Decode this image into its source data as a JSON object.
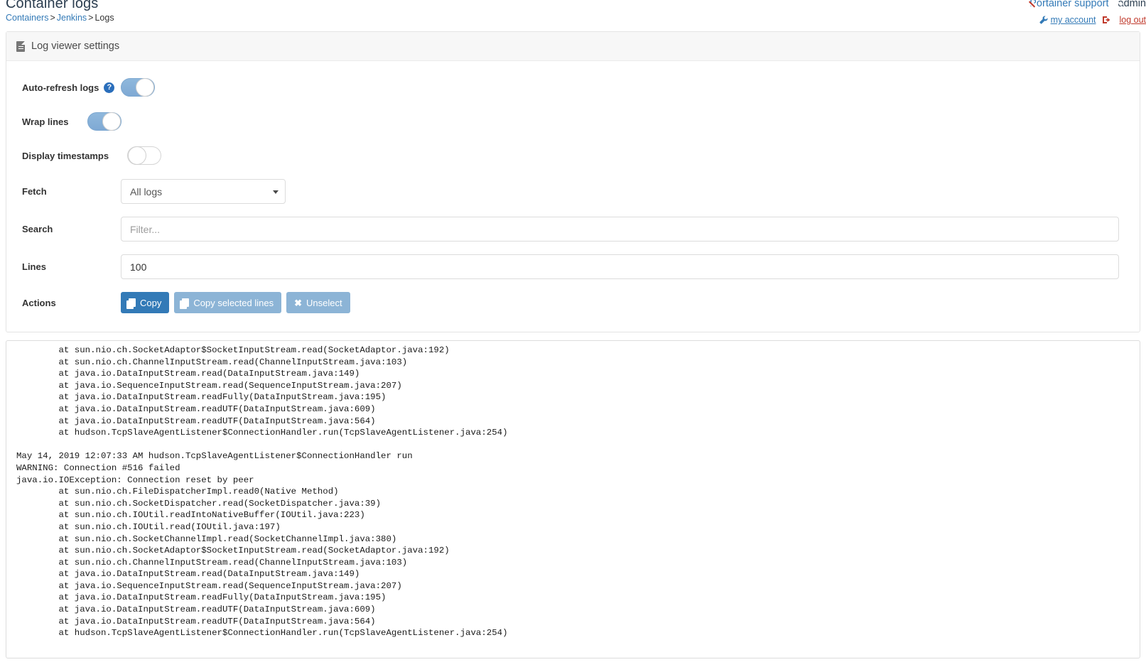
{
  "header": {
    "title": "Container logs",
    "breadcrumb": {
      "containers": "Containers",
      "separator1": ">",
      "jenkins": "Jenkins",
      "separator2": ">",
      "current": "Logs"
    },
    "support_label": "Portainer support",
    "user_name": "admin",
    "my_account_label": "my account",
    "logout_label": "log out"
  },
  "settings_panel": {
    "heading": "Log viewer settings",
    "rows": {
      "auto_refresh": {
        "label": "Auto-refresh logs",
        "state": "on"
      },
      "wrap_lines": {
        "label": "Wrap lines",
        "state": "on"
      },
      "display_timestamps": {
        "label": "Display timestamps",
        "state": "off"
      },
      "fetch": {
        "label": "Fetch",
        "selected": "All logs",
        "options": [
          "All logs"
        ]
      },
      "search": {
        "label": "Search",
        "placeholder": "Filter...",
        "value": ""
      },
      "lines": {
        "label": "Lines",
        "value": "100"
      },
      "actions": {
        "label": "Actions",
        "copy": "Copy",
        "copy_selected": "Copy selected lines",
        "unselect": "Unselect"
      }
    }
  },
  "log_viewer": {
    "lines": [
      "        at sun.nio.ch.SocketAdaptor$SocketInputStream.read(SocketAdaptor.java:192)",
      "        at sun.nio.ch.ChannelInputStream.read(ChannelInputStream.java:103)",
      "        at java.io.DataInputStream.read(DataInputStream.java:149)",
      "        at java.io.SequenceInputStream.read(SequenceInputStream.java:207)",
      "        at java.io.DataInputStream.readFully(DataInputStream.java:195)",
      "        at java.io.DataInputStream.readUTF(DataInputStream.java:609)",
      "        at java.io.DataInputStream.readUTF(DataInputStream.java:564)",
      "        at hudson.TcpSlaveAgentListener$ConnectionHandler.run(TcpSlaveAgentListener.java:254)",
      "",
      "May 14, 2019 12:07:33 AM hudson.TcpSlaveAgentListener$ConnectionHandler run",
      "WARNING: Connection #516 failed",
      "java.io.IOException: Connection reset by peer",
      "        at sun.nio.ch.FileDispatcherImpl.read0(Native Method)",
      "        at sun.nio.ch.SocketDispatcher.read(SocketDispatcher.java:39)",
      "        at sun.nio.ch.IOUtil.readIntoNativeBuffer(IOUtil.java:223)",
      "        at sun.nio.ch.IOUtil.read(IOUtil.java:197)",
      "        at sun.nio.ch.SocketChannelImpl.read(SocketChannelImpl.java:380)",
      "        at sun.nio.ch.SocketAdaptor$SocketInputStream.read(SocketAdaptor.java:192)",
      "        at sun.nio.ch.ChannelInputStream.read(ChannelInputStream.java:103)",
      "        at java.io.DataInputStream.read(DataInputStream.java:149)",
      "        at java.io.SequenceInputStream.read(SequenceInputStream.java:207)",
      "        at java.io.DataInputStream.readFully(DataInputStream.java:195)",
      "        at java.io.DataInputStream.readUTF(DataInputStream.java:609)",
      "        at java.io.DataInputStream.readUTF(DataInputStream.java:564)",
      "        at hudson.TcpSlaveAgentListener$ConnectionHandler.run(TcpSlaveAgentListener.java:254)"
    ]
  },
  "colors": {
    "accent": "#337ab7",
    "toggle_on": "#8fb8dc",
    "danger": "#c0392b",
    "button_light": "#8cb4d6"
  }
}
